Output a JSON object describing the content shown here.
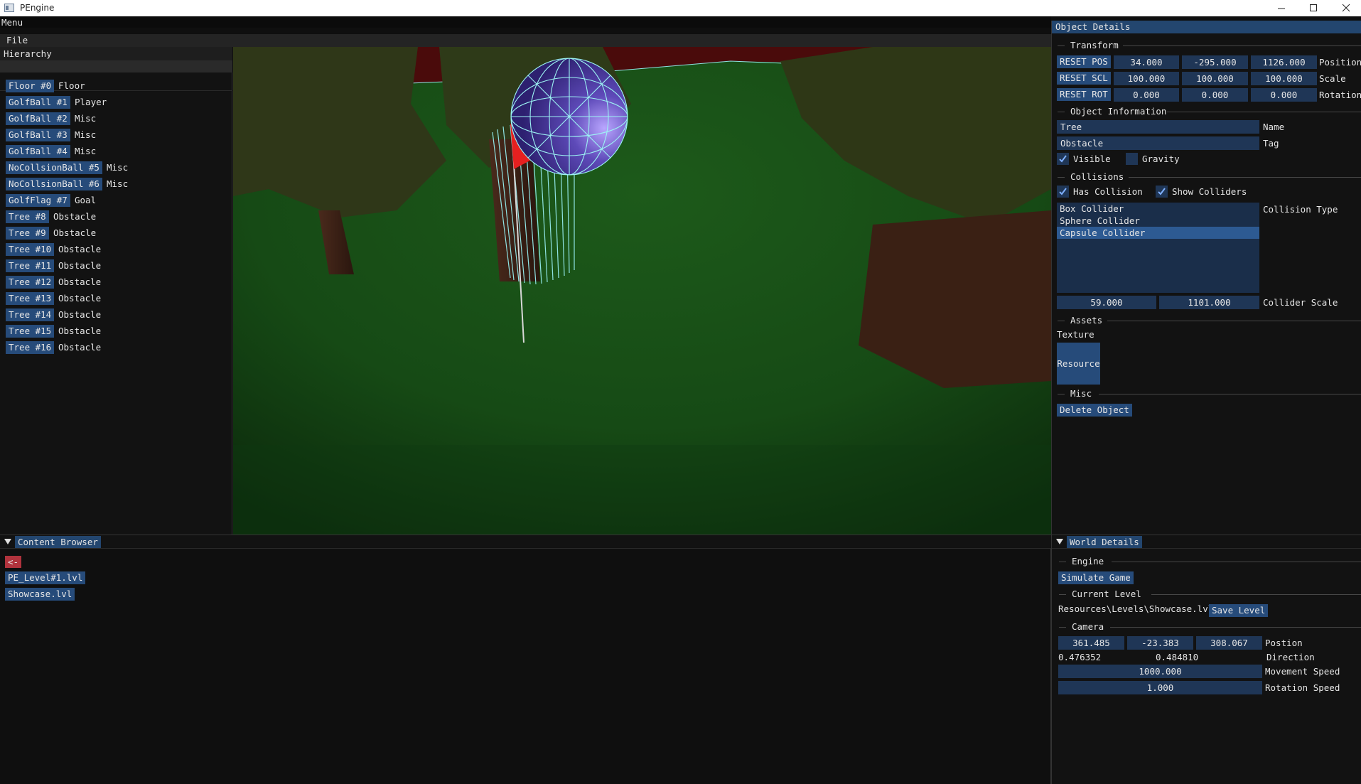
{
  "window": {
    "title": "PEngine"
  },
  "menubar": {
    "menu_label": "Menu",
    "file_label": "File"
  },
  "hierarchy": {
    "title": "Hierarchy",
    "items": [
      {
        "button": "Floor #0",
        "tag": "Floor"
      },
      {
        "button": "GolfBall #1",
        "tag": "Player"
      },
      {
        "button": "GolfBall #2",
        "tag": "Misc"
      },
      {
        "button": "GolfBall #3",
        "tag": "Misc"
      },
      {
        "button": "GolfBall #4",
        "tag": "Misc"
      },
      {
        "button": "NoCollsionBall #5",
        "tag": "Misc"
      },
      {
        "button": "NoCollsionBall #6",
        "tag": "Misc"
      },
      {
        "button": "GolfFlag #7",
        "tag": "Goal"
      },
      {
        "button": "Tree #8",
        "tag": "Obstacle"
      },
      {
        "button": "Tree #9",
        "tag": "Obstacle"
      },
      {
        "button": "Tree #10",
        "tag": "Obstacle"
      },
      {
        "button": "Tree #11",
        "tag": "Obstacle"
      },
      {
        "button": "Tree #12",
        "tag": "Obstacle"
      },
      {
        "button": "Tree #13",
        "tag": "Obstacle"
      },
      {
        "button": "Tree #14",
        "tag": "Obstacle"
      },
      {
        "button": "Tree #15",
        "tag": "Obstacle"
      },
      {
        "button": "Tree #16",
        "tag": "Obstacle"
      }
    ]
  },
  "object_details": {
    "title": "Object Details",
    "transform": {
      "header": "Transform",
      "reset_pos": "RESET POS",
      "reset_scl": "RESET SCL",
      "reset_rot": "RESET ROT",
      "position": [
        "34.000",
        "-295.000",
        "1126.000"
      ],
      "scale": [
        "100.000",
        "100.000",
        "100.000"
      ],
      "rotation": [
        "0.000",
        "0.000",
        "0.000"
      ],
      "position_label": "Position",
      "scale_label": "Scale",
      "rotation_label": "Rotation"
    },
    "info": {
      "header": "Object Information",
      "name_value": "Tree",
      "name_label": "Name",
      "tag_value": "Obstacle",
      "tag_label": "Tag",
      "visible_label": "Visible",
      "visible_checked": true,
      "gravity_label": "Gravity",
      "gravity_checked": false
    },
    "collisions": {
      "header": "Collisions",
      "has_collision_label": "Has Collision",
      "show_colliders_label": "Show Colliders",
      "types": [
        "Box Collider",
        "Sphere Collider",
        "Capsule Collider"
      ],
      "selected_type": "Capsule Collider",
      "type_label": "Collision Type",
      "scale_values": [
        "59.000",
        "1101.000"
      ],
      "scale_label": "Collider Scale"
    },
    "assets": {
      "header": "Assets",
      "texture_label": "Texture",
      "resource_button": "Resource"
    },
    "misc": {
      "header": "Misc",
      "delete_button": "Delete Object"
    }
  },
  "content_browser": {
    "title": "Content Browser",
    "back_button": "<-",
    "files": [
      "PE_Level#1.lvl",
      "Showcase.lvl"
    ]
  },
  "world_details": {
    "title": "World Details",
    "engine_header": "Engine",
    "simulate_button": "Simulate Game",
    "level_header": "Current Level",
    "level_path": "Resources\\Levels\\Showcase.lvl",
    "save_button": "Save Level",
    "camera_header": "Camera",
    "position": [
      "361.485",
      "-23.383",
      "308.067"
    ],
    "position_label": "Postion",
    "direction": [
      "0.476352",
      "0.484810"
    ],
    "direction_label": "Direction",
    "movement_speed": "1000.000",
    "movement_label": "Movement Speed",
    "rotation_speed": "1.000",
    "rotation_label": "Rotation Speed"
  },
  "colors": {
    "accent": "#264b7a",
    "field": "#1f3656",
    "header": "#23466f",
    "back_button": "#b0333d"
  }
}
